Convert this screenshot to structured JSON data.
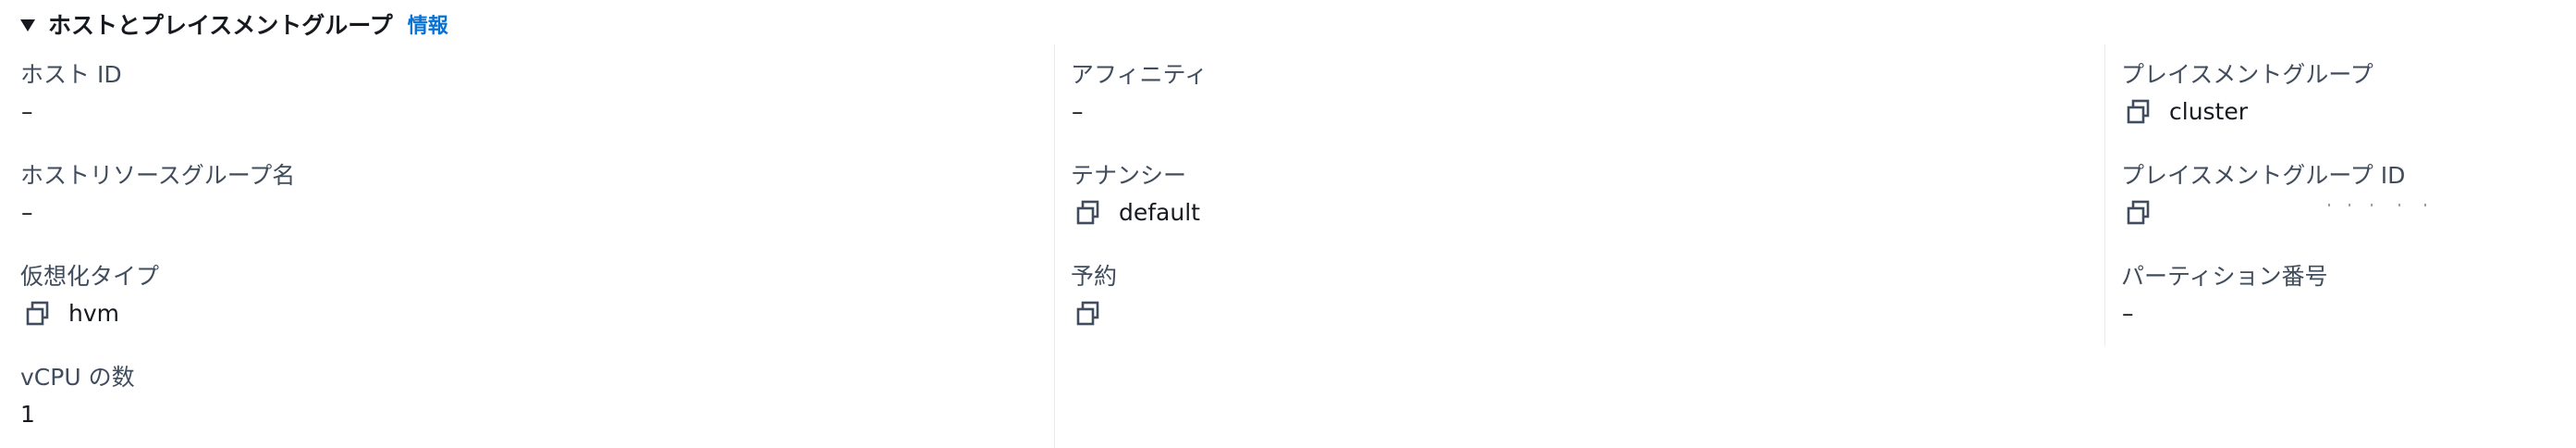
{
  "section": {
    "title": "ホストとプレイスメントグループ",
    "info_link": "情報",
    "icons": {
      "toggle": "caret-down-icon",
      "copy": "copy-icon"
    }
  },
  "columns": {
    "left": [
      {
        "label": "ホスト ID",
        "value": "–",
        "copyable": false
      },
      {
        "label": "ホストリソースグループ名",
        "value": "–",
        "copyable": false
      },
      {
        "label": "仮想化タイプ",
        "value": "hvm",
        "copyable": true
      },
      {
        "label": "vCPU の数",
        "value": "1",
        "copyable": false
      }
    ],
    "middle": [
      {
        "label": "アフィニティ",
        "value": "–",
        "copyable": false
      },
      {
        "label": "テナンシー",
        "value": "default",
        "copyable": true
      },
      {
        "label": "予約",
        "value": "",
        "copyable": true
      }
    ],
    "right": [
      {
        "label": "プレイスメントグループ",
        "value": "cluster",
        "copyable": true
      },
      {
        "label": "プレイスメントグループ ID",
        "value": "",
        "copyable": true,
        "redacted": true
      },
      {
        "label": "パーティション番号",
        "value": "–",
        "copyable": false
      }
    ]
  },
  "colors": {
    "link": "#0972d3",
    "label": "#414d5c",
    "text": "#16191f",
    "divider": "#e9ebed"
  }
}
